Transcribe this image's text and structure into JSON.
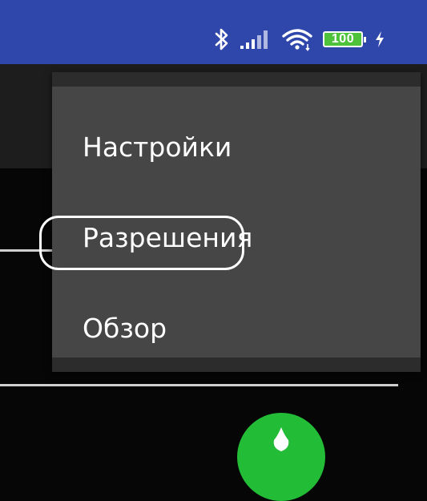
{
  "status_bar": {
    "icons": [
      "bluetooth-icon",
      "signal-icon",
      "wifi-icon",
      "battery-icon",
      "charging-icon"
    ],
    "battery_level": "100",
    "battery_color": "#4ec23a",
    "background": "#2f46ab"
  },
  "menu": {
    "items": [
      {
        "label": "Настройки"
      },
      {
        "label": "Разрешения",
        "highlighted": true
      },
      {
        "label": "Обзор"
      }
    ]
  },
  "fab": {
    "color": "#22bc36"
  }
}
